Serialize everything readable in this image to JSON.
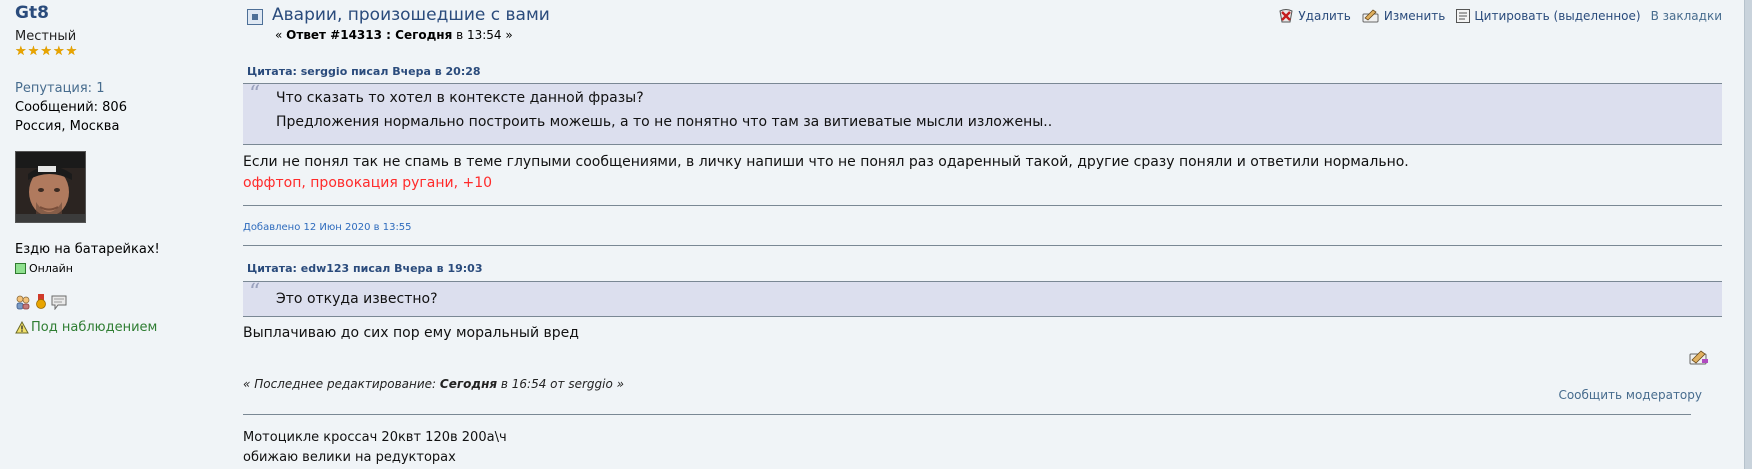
{
  "poster": {
    "name": "Gt8",
    "rank": "Местный",
    "stars": 5,
    "reputation": "Репутация: 1",
    "posts": "Сообщений: 806",
    "location": "Россия, Москва",
    "personal_text": "Ездю на батарейках!",
    "online": "Онлайн",
    "watch": "Под наблюдением"
  },
  "post": {
    "title": "Аварии, произошедшие с вами",
    "reply_prefix": "« ",
    "reply_number": "Ответ #14313 : Сегодня",
    "reply_time": " в 13:54 »"
  },
  "actions": {
    "delete": "Удалить",
    "edit": "Изменить",
    "quote": "Цитировать (выделенное)",
    "bookmark": "В закладки"
  },
  "quote1": {
    "header": "Цитата: serggio писал Вчера в 20:28",
    "line1": "Что сказать то хотел в контексте данной фразы?",
    "line2": "Предложения нормально построить можешь, а то не понятно что там за витиеватые мысли изложены.."
  },
  "body1": "Если не понял так не спамь в теме глупыми сообщениями, в личку напиши что не понял раз одаренный такой,  другие сразу поняли и ответили нормально.",
  "mod_note": "оффтоп, провокация ругани, +10",
  "added": "Добавлено 12 Июн 2020 в 13:55",
  "quote2": {
    "header": "Цитата: edw123 писал Вчера в 19:03",
    "line1": "Это откуда известно?"
  },
  "body2": "Выплачиваю до сих пор ему моральный вред",
  "edited": {
    "prefix": "« Последнее редактирование: ",
    "when": "Сегодня",
    "suffix": " в 16:54 от serggio »"
  },
  "report": "Сообщить модератору",
  "signature": {
    "line1": "Мотоцикле кроссач 20квт   120в 200а\\ч",
    "line2": "обижаю велики на редукторах"
  },
  "colors": {
    "background": "#f0f4f7",
    "link": "#2a4b7c",
    "quote_bg": "#dcdfee",
    "mod_note": "#ff2b2b"
  }
}
